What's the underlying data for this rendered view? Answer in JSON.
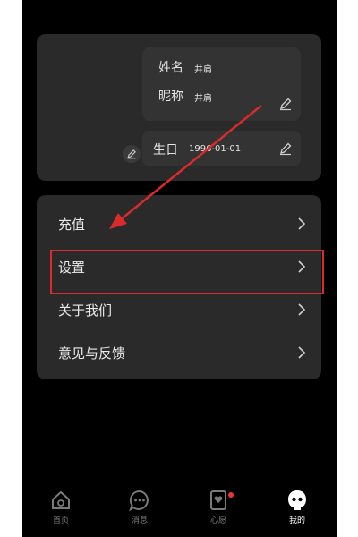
{
  "profile": {
    "name_label": "姓名",
    "name_value": "井肩",
    "nickname_label": "昵称",
    "nickname_value": "井肩",
    "birthday_label": "生日",
    "birthday_value": "1996-01-01"
  },
  "menu": {
    "items": [
      {
        "label": "充值"
      },
      {
        "label": "设置"
      },
      {
        "label": "关于我们"
      },
      {
        "label": "意见与反馈"
      }
    ]
  },
  "tabbar": {
    "items": [
      {
        "label": "首页",
        "icon": "home-icon"
      },
      {
        "label": "消息",
        "icon": "message-icon"
      },
      {
        "label": "心愿",
        "icon": "wish-icon"
      },
      {
        "label": "我的",
        "icon": "profile-icon"
      }
    ],
    "active": "我的"
  },
  "colors": {
    "highlight": "#d92b2b",
    "notification_dot": "#e53935"
  }
}
